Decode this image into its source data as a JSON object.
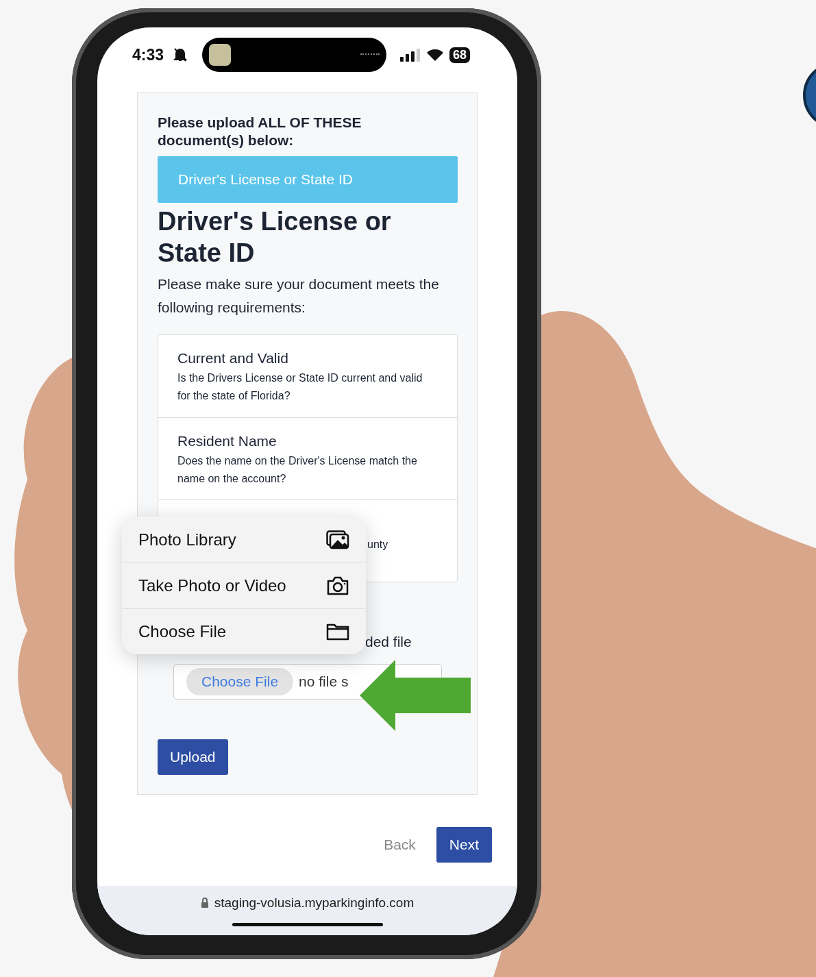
{
  "status_bar": {
    "time": "4:33",
    "battery": "68"
  },
  "form": {
    "instruction": "Please upload ALL OF THESE document(s) below:",
    "banner": "Driver's License or State ID",
    "heading": "Driver's License or State ID",
    "intro": "Please make sure your document meets the following requirements:",
    "requirements": [
      {
        "title": "Current and Valid",
        "description": "Is the Drivers License or State ID current and valid for the state of Florida?"
      },
      {
        "title": "Resident Name",
        "description": "Does the name on the Driver's License match the name on the account?"
      },
      {
        "description": "unty"
      }
    ],
    "upload_label": "ded file",
    "file_input": {
      "button": "Choose File",
      "status": "no file s"
    },
    "upload_button": "Upload"
  },
  "menu": {
    "items": [
      {
        "label": "Photo Library",
        "kind": "photos"
      },
      {
        "label": "Take Photo or Video",
        "kind": "camera"
      },
      {
        "label": "Choose File",
        "kind": "folder"
      }
    ]
  },
  "nav": {
    "back": "Back",
    "next": "Next"
  },
  "url_bar": {
    "url": "staging-volusia.myparkinginfo.com"
  }
}
